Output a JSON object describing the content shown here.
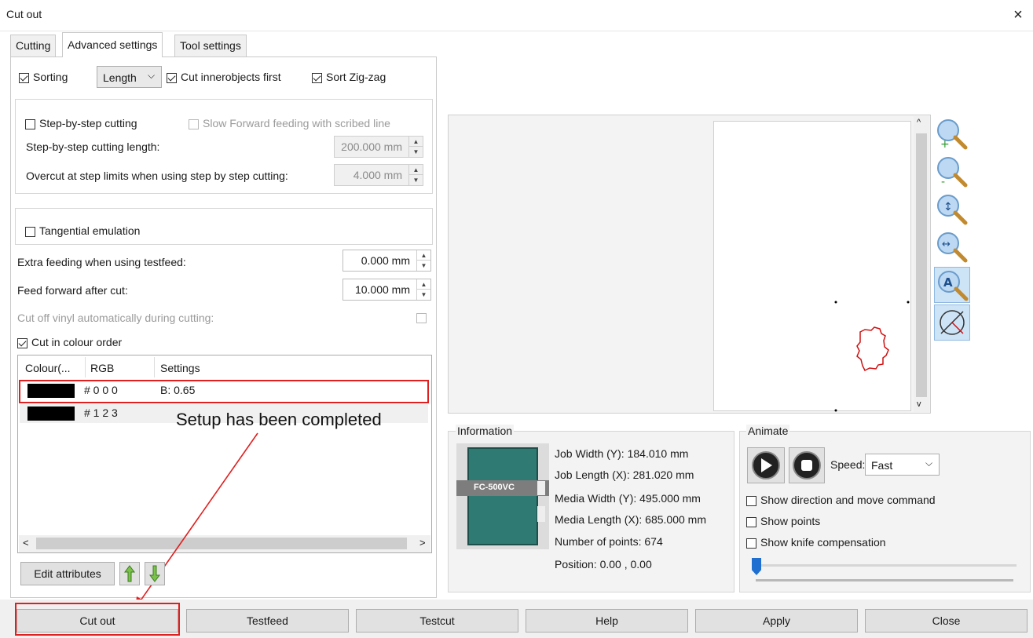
{
  "window": {
    "title": "Cut out",
    "close_icon": "close-icon"
  },
  "tabs": [
    {
      "label": "Cutting",
      "active": false
    },
    {
      "label": "Advanced settings",
      "active": true
    },
    {
      "label": "Tool settings",
      "active": false
    }
  ],
  "sorting": {
    "sorting_label": "Sorting",
    "sorting_checked": true,
    "sort_by": "Length",
    "inner_label": "Cut innerobjects first",
    "inner_checked": true,
    "zigzag_label": "Sort Zig-zag",
    "zigzag_checked": true
  },
  "step_group": {
    "step_label": "Step-by-step cutting",
    "step_checked": false,
    "slow_label": "Slow Forward feeding with scribed line",
    "slow_checked": false,
    "length_label": "Step-by-step cutting length:",
    "length_value": "200.000 mm",
    "overcut_label": "Overcut at step limits when using step by step cutting:",
    "overcut_value": "4.000 mm"
  },
  "tangential": {
    "label": "Tangential emulation",
    "checked": false
  },
  "feeding": {
    "extra_label": "Extra feeding when using testfeed:",
    "extra_value": "0.000 mm",
    "forward_label": "Feed forward after cut:",
    "forward_value": "10.000 mm",
    "cutoff_label": "Cut off vinyl automatically during cutting:",
    "cutoff_checked": false
  },
  "colour_order": {
    "label": "Cut in colour order",
    "checked": true
  },
  "colour_table": {
    "headers": [
      "Colour(...",
      "RGB",
      "Settings"
    ],
    "rows": [
      {
        "swatch": "#000000",
        "rgb": "# 0 0 0",
        "settings": "B: 0.65"
      },
      {
        "swatch": "#000000",
        "rgb": "# 1 2 3",
        "settings": ""
      }
    ]
  },
  "annotation": {
    "text": "Setup has been completed",
    "color": "#e02020"
  },
  "edit_attributes_label": "Edit attributes",
  "information": {
    "title": "Information",
    "device_label": "FC-500VC",
    "lines": [
      "Job Width (Y): 184.010 mm",
      "Job Length (X): 281.020 mm",
      "Media Width (Y): 495.000 mm",
      "Media Length (X): 685.000 mm",
      "Number of points: 674",
      "Position: 0.00 , 0.00"
    ]
  },
  "animate": {
    "title": "Animate",
    "speed_label": "Speed:",
    "speed_value": "Fast",
    "options": [
      {
        "label": "Show direction and move command",
        "checked": false
      },
      {
        "label": "Show points",
        "checked": false
      },
      {
        "label": "Show knife compensation",
        "checked": false
      }
    ]
  },
  "zoom_tools": [
    "zoom-in-icon",
    "zoom-out-icon",
    "zoom-fit-height-icon",
    "zoom-fit-width-icon",
    "zoom-auto-icon",
    "zoom-none-icon"
  ],
  "buttons": [
    "Cut out",
    "Testfeed",
    "Testcut",
    "Help",
    "Apply",
    "Close"
  ],
  "colors": {
    "highlight": "#e02020",
    "tool_active": "#cde4f7",
    "device": "#2f7a72"
  }
}
